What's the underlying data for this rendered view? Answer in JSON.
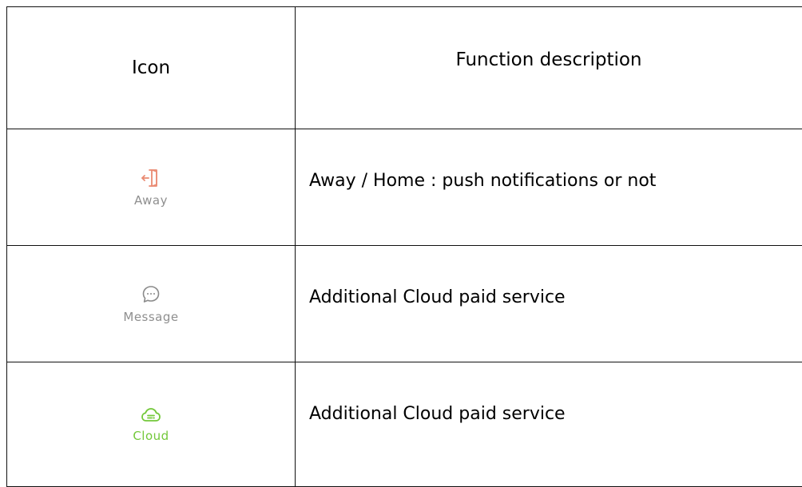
{
  "table": {
    "headers": {
      "icon": "Icon",
      "description": "Function description"
    },
    "rows": [
      {
        "icon_name": "away-door-icon",
        "icon_label": "Away",
        "icon_color": "#ea8a72",
        "description": "Away / Home : push notifications or not"
      },
      {
        "icon_name": "message-bubble-icon",
        "icon_label": "Message",
        "icon_color": "#8f8f8f",
        "description": "Additional Cloud paid service"
      },
      {
        "icon_name": "cloud-icon",
        "icon_label": "Cloud",
        "icon_color": "#73c83a",
        "description": "Additional Cloud paid service"
      }
    ]
  }
}
